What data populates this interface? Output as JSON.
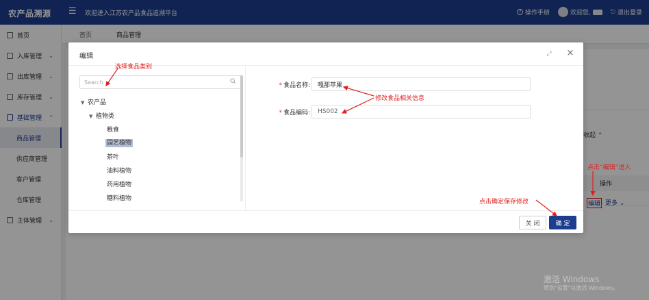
{
  "header": {
    "logo": "农产品溯源",
    "welcome": "欢迎进入江苏农产品食品追溯平台",
    "manual": "操作手册",
    "greeting": "欢迎您,",
    "logout": "退出登录"
  },
  "sidebar": {
    "items": [
      {
        "label": "首页"
      },
      {
        "label": "入库管理"
      },
      {
        "label": "出库管理"
      },
      {
        "label": "库存管理"
      },
      {
        "label": "基础管理"
      },
      {
        "label": "商品管理"
      },
      {
        "label": "供应商管理"
      },
      {
        "label": "客户管理"
      },
      {
        "label": "仓库管理"
      },
      {
        "label": "主体管理"
      }
    ]
  },
  "tabs": [
    {
      "label": "首页"
    },
    {
      "label": "商品管理"
    }
  ],
  "background": {
    "collapse": "收起",
    "column_action": "操作",
    "edit_link": "编辑",
    "more_link": "更多"
  },
  "modal": {
    "title": "编辑",
    "search_placeholder": "Search",
    "tree": [
      {
        "label": "农产品",
        "level": 0,
        "expanded": true
      },
      {
        "label": "植物类",
        "level": 1,
        "expanded": true
      },
      {
        "label": "粮食",
        "level": 2
      },
      {
        "label": "园艺植物",
        "level": 2,
        "selected": true
      },
      {
        "label": "茶叶",
        "level": 2
      },
      {
        "label": "油料植物",
        "level": 2
      },
      {
        "label": "药用植物",
        "level": 2
      },
      {
        "label": "糖料植物",
        "level": 2
      }
    ],
    "form": {
      "name_label": "食品名称:",
      "name_value": "嘎那苹果",
      "code_label": "食品编码:",
      "code_value": "HS002"
    },
    "buttons": {
      "close": "关 闭",
      "ok": "确 定"
    }
  },
  "annotations": {
    "select_category": "选择食品类别",
    "modify_info": "修改食品相关信息",
    "click_edit": "点击“编辑”进入",
    "click_ok": "点击确定保存修改"
  },
  "watermark": {
    "line1": "激活 Windows",
    "line2": "转到\"设置\"以激活 Windows。"
  },
  "colors": {
    "brand": "#1d3d8f",
    "annotation": "#e02020"
  }
}
